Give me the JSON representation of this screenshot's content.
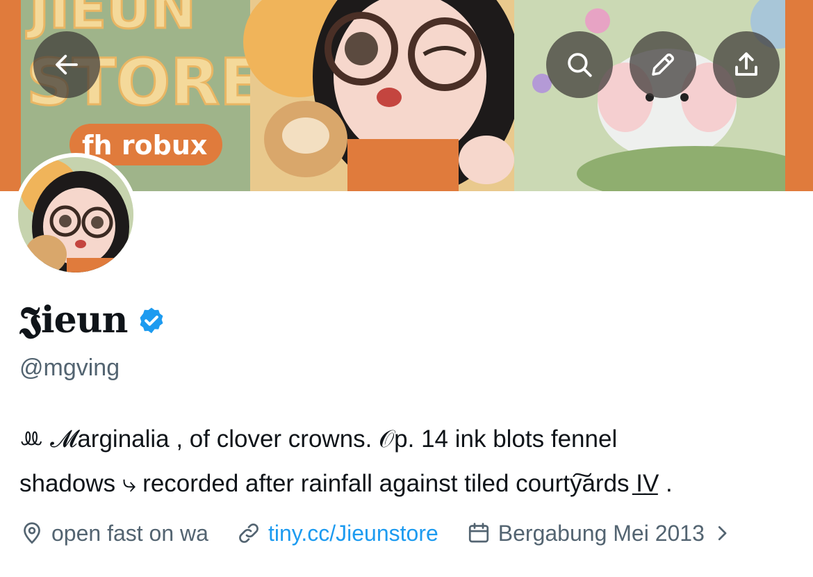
{
  "header": {
    "back_icon": "arrow-left-icon",
    "search_icon": "search-icon",
    "edit_icon": "pencil-icon",
    "share_icon": "share-upload-icon",
    "banner_text": {
      "line1": "JIEUN",
      "line2": "STORE",
      "tag": "fh robux"
    }
  },
  "profile": {
    "display_name": "𝕵ieun",
    "verified": true,
    "verified_color": "#1d9bf0",
    "handle": "@mgving",
    "bio_line1": "ꔛ 𝓜arginalia , of clover crowns. 𝒪p. 14 ink blots fennel",
    "bio_line2": "shadows ⤷ recorded after rainfall against tiled courty͠ards I̲V̲ .",
    "location": "open fast on wa",
    "location_icon": "location-pin-icon",
    "website": "tiny.cc/Jieunstore",
    "website_icon": "link-icon",
    "joined": "Bergabung Mei 2013",
    "joined_icon": "calendar-icon",
    "more_icon": "chevron-right-icon"
  },
  "colors": {
    "text_primary": "#0f1419",
    "text_secondary": "#536471",
    "link": "#1d9bf0",
    "banner_orange": "#e07b3c",
    "banner_cream": "#f4d99a",
    "button_overlay": "rgba(60,56,54,0.72)"
  }
}
